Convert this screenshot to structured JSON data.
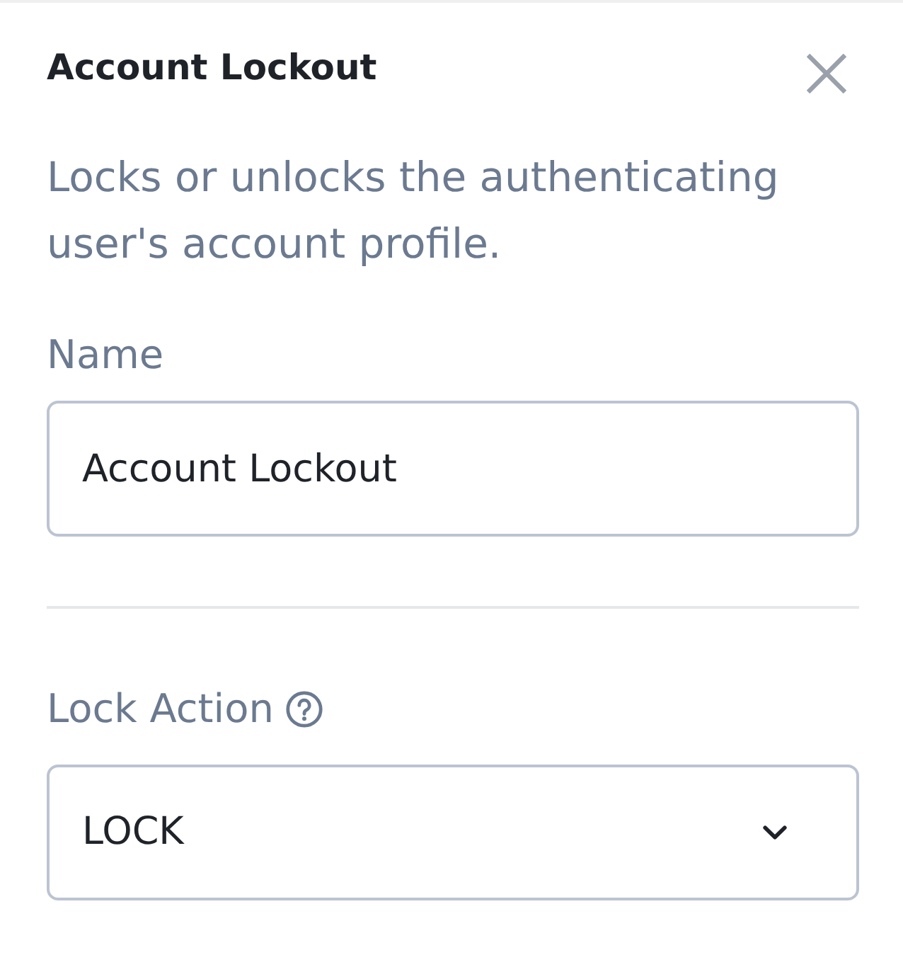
{
  "panel": {
    "title": "Account Lockout",
    "description": "Locks or unlocks the authenticating user's account profile."
  },
  "fields": [
    {
      "kind": "text",
      "label": "Name",
      "value": "Account Lockout",
      "help": false
    },
    {
      "kind": "select",
      "label": "Lock Action",
      "value": "LOCK",
      "help": true
    }
  ]
}
